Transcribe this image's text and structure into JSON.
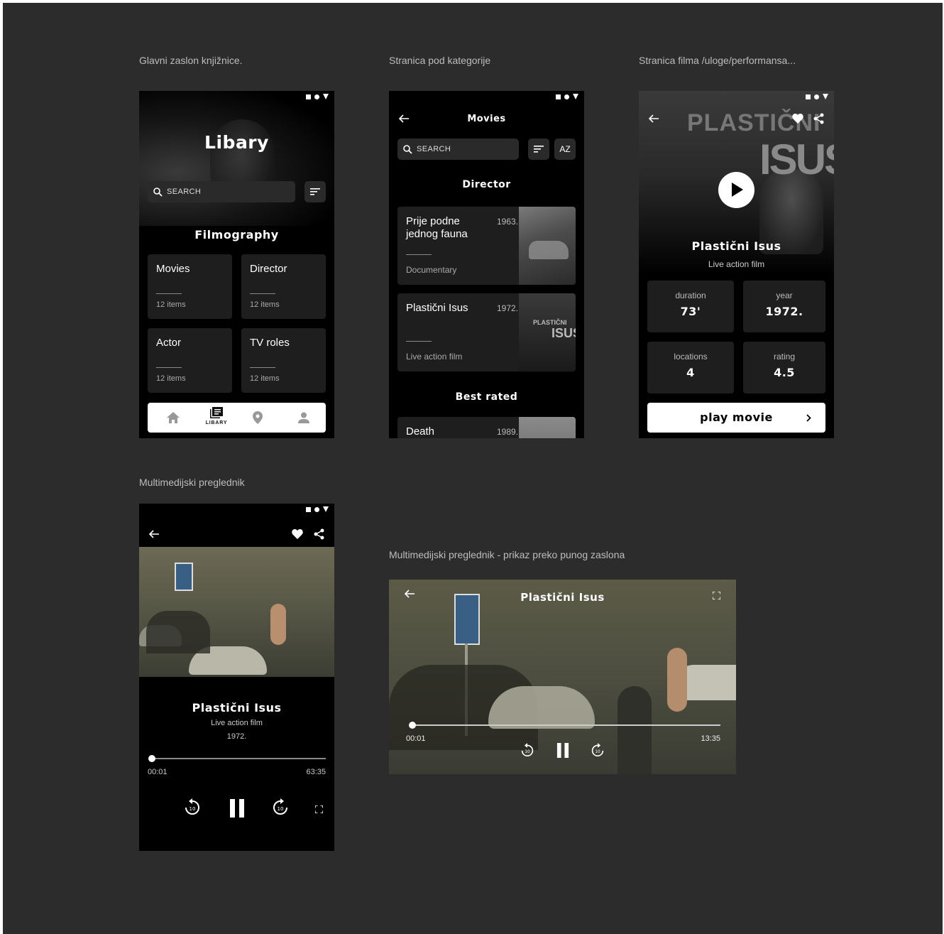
{
  "captions": {
    "library": "Glavni zaslon knjižnice.",
    "category": "Stranica pod kategorije",
    "film": "Stranica filma /uloge/performansa...",
    "player": "Multimedijski preglednik",
    "fullscreen": "Multimedijski preglednik - prikaz preko punog zaslona"
  },
  "library": {
    "title": "Libary",
    "search_placeholder": "SEARCH",
    "section": "Filmography",
    "cards": [
      {
        "label": "Movies",
        "count": "12 items"
      },
      {
        "label": "Director",
        "count": "12 items"
      },
      {
        "label": "Actor",
        "count": "12 items"
      },
      {
        "label": "TV roles",
        "count": "12 items"
      }
    ],
    "nav_active": "LIBARY"
  },
  "category": {
    "title": "Movies",
    "search_placeholder": "SEARCH",
    "sort_az": "AZ",
    "section1": "Director",
    "items": [
      {
        "title": "Prije podne jednog fauna",
        "year": "1963.",
        "genre": "Documentary"
      },
      {
        "title": "Plastični Isus",
        "year": "1972.",
        "genre": "Live action film"
      }
    ],
    "section2": "Best rated",
    "peek": {
      "title": "Death",
      "year": "1989."
    }
  },
  "film": {
    "poster_text1": "PLASTIČNI",
    "poster_text2": "ISUS",
    "title": "Plastični Isus",
    "subtitle": "Live action film",
    "stats": [
      {
        "label": "duration",
        "value": "73'"
      },
      {
        "label": "year",
        "value": "1972."
      },
      {
        "label": "locations",
        "value": "4"
      },
      {
        "label": "rating",
        "value": "4.5"
      }
    ],
    "play_label": "play movie"
  },
  "player": {
    "title": "Plastični Isus",
    "subtitle": "Live action film",
    "year": "1972.",
    "time_current": "00:01",
    "time_total": "63:35",
    "skip_seconds": "10",
    "progress": 0.01
  },
  "fullscreen": {
    "title": "Plastični Isus",
    "time_current": "00:01",
    "time_total": "13:35",
    "skip_seconds": "10",
    "progress": 0.01
  },
  "colors": {
    "bg": "#2c2c2c",
    "phone": "#000000",
    "card": "#1e1e1e",
    "accent": "#ffffff"
  }
}
